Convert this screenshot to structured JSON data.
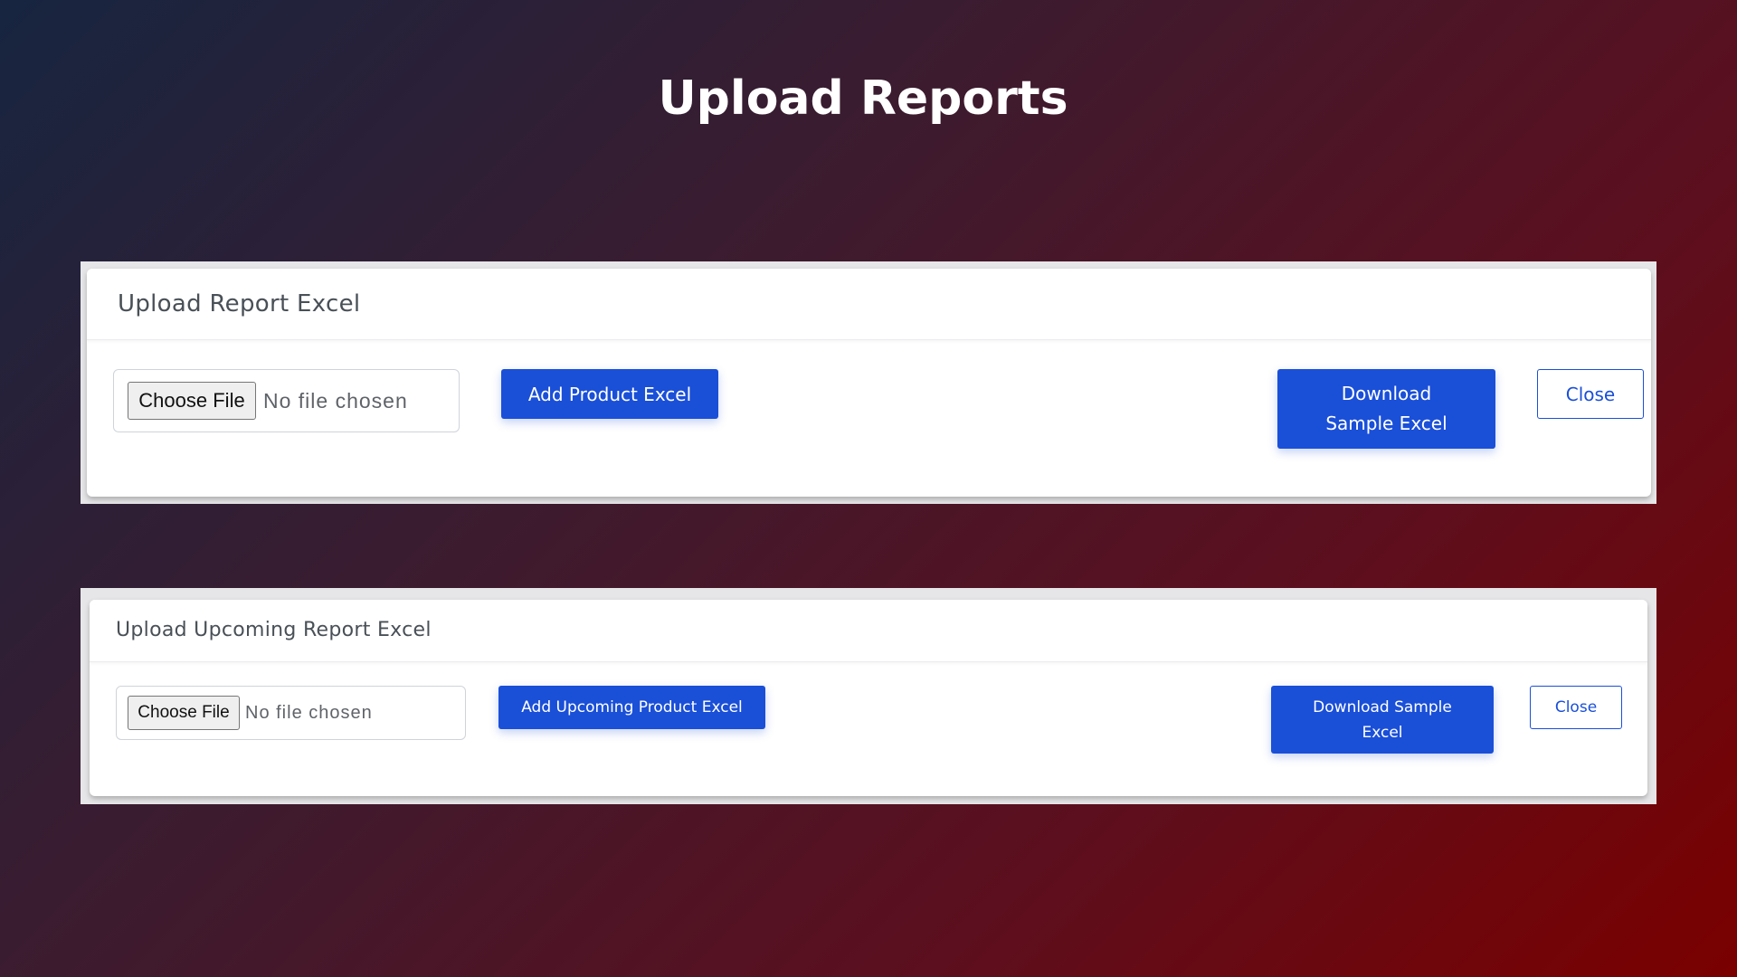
{
  "page": {
    "title": "Upload Reports"
  },
  "panels": [
    {
      "header": "Upload Report Excel",
      "file_input": {
        "choose_label": "Choose File",
        "status": "No file chosen"
      },
      "add_button": "Add Product Excel",
      "download_button": "Download Sample Excel",
      "close_button": "Close"
    },
    {
      "header": "Upload Upcoming Report Excel",
      "file_input": {
        "choose_label": "Choose File",
        "status": "No file chosen"
      },
      "add_button": "Add Upcoming Product Excel",
      "download_button": "Download Sample Excel",
      "close_button": "Close"
    }
  ],
  "colors": {
    "primary": "#1a4fd8",
    "background_start": "#172540",
    "background_end": "#7a0000"
  }
}
